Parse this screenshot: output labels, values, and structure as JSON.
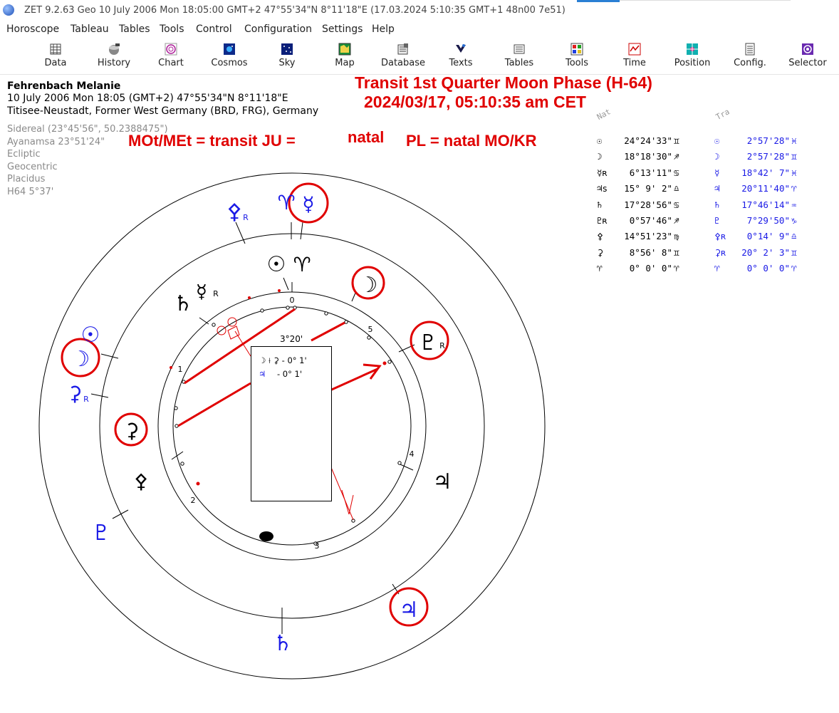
{
  "window": {
    "title": "ZET 9.2.63 Geo    10 July 2006  Mon  18:05:00 GMT+2 47°55'34\"N  8°11'18\"E  (17.03.2024   5:10:35 GMT+1 48n00 7e51)"
  },
  "menu": [
    "Horoscope",
    "Tableau",
    "Tables",
    "Tools",
    "Control",
    "Configuration",
    "Settings",
    "Help"
  ],
  "toolbar": [
    {
      "label": "Data",
      "icon": "data-grid-icon"
    },
    {
      "label": "History",
      "icon": "history-icon"
    },
    {
      "label": "Chart",
      "icon": "chart-wheel-icon"
    },
    {
      "label": "Cosmos",
      "icon": "cosmos-icon"
    },
    {
      "label": "Sky",
      "icon": "sky-icon"
    },
    {
      "label": "Map",
      "icon": "map-icon"
    },
    {
      "label": "Database",
      "icon": "database-icon"
    },
    {
      "label": "Texts",
      "icon": "texts-icon"
    },
    {
      "label": "Tables",
      "icon": "tables-icon"
    },
    {
      "label": "Tools",
      "icon": "tools-icon"
    },
    {
      "label": "Time",
      "icon": "time-icon"
    },
    {
      "label": "Position",
      "icon": "position-icon"
    },
    {
      "label": "Config.",
      "icon": "config-icon"
    },
    {
      "label": "Selector",
      "icon": "selector-icon"
    }
  ],
  "person": {
    "name": "Fehrenbach Melanie",
    "datetime": "10 July 2006  Mon  18:05 (GMT+2) 47°55'34\"N  8°11'18\"E",
    "place": "Titisee-Neustadt, Former West Germany (BRD, FRG), Germany"
  },
  "settings": [
    "Sidereal (23°45'56\", 50.2388475\")",
    "Ayanamsa 23°51'24\"",
    "Ecliptic",
    "Geocentric",
    "Placidus",
    "H64   5°37'"
  ],
  "annotations": {
    "title1": "Transit 1st Quarter Moon Phase (H-64)",
    "title2": "2024/03/17, 05:10:35 am CET",
    "formula_a": "MOt/MEt = transit JU =",
    "formula_b": "natal",
    "formula_c": "PL = natal MO/KR"
  },
  "table": {
    "nat_header": "Nat",
    "tra_header": "Tra",
    "natal": [
      {
        "glyph": "☉",
        "value": "24°24'33\"",
        "sign": "♊"
      },
      {
        "glyph": "☽",
        "value": "18°18'30\"",
        "sign": "♐"
      },
      {
        "glyph": "☿ʀ",
        "value": "6°13'11\"",
        "sign": "♋"
      },
      {
        "glyph": "♃s",
        "value": "15° 9' 2\"",
        "sign": "♎"
      },
      {
        "glyph": "♄",
        "value": "17°28'56\"",
        "sign": "♋"
      },
      {
        "glyph": "♇ʀ",
        "value": "0°57'46\"",
        "sign": "♐"
      },
      {
        "glyph": "⚴",
        "value": "14°51'23\"",
        "sign": "♍"
      },
      {
        "glyph": "⚳",
        "value": "8°56' 8\"",
        "sign": "♊"
      },
      {
        "glyph": "♈",
        "value": "0° 0' 0\"",
        "sign": "♈"
      }
    ],
    "transit": [
      {
        "glyph": "☉",
        "value": "2°57'28\"",
        "sign": "♓"
      },
      {
        "glyph": "☽",
        "value": "2°57'28\"",
        "sign": "♊"
      },
      {
        "glyph": "☿",
        "value": "18°42' 7\"",
        "sign": "♓"
      },
      {
        "glyph": "♃",
        "value": "20°11'40\"",
        "sign": "♈"
      },
      {
        "glyph": "♄",
        "value": "17°46'14\"",
        "sign": "♒"
      },
      {
        "glyph": "♇",
        "value": "7°29'50\"",
        "sign": "♑"
      },
      {
        "glyph": "⚴ʀ",
        "value": "0°14' 9\"",
        "sign": "♎"
      },
      {
        "glyph": "⚳ʀ",
        "value": "20° 2' 3\"",
        "sign": "♊"
      },
      {
        "glyph": "♈",
        "value": "0° 0' 0\"",
        "sign": "♈"
      }
    ]
  },
  "popup": {
    "header": "3°20'",
    "row1": "☽ ⟊ ⚳ - 0° 1'",
    "row2_glyph": "♃",
    "row2_value": "- 0° 1'"
  },
  "wheel": {
    "house_numbers": [
      "1",
      "2",
      "3",
      "4",
      "5",
      "0"
    ],
    "outer_glyphs": [
      {
        "g": "⚴",
        "r": "R",
        "color": "#1a1ae6"
      },
      {
        "g": "♈",
        "color": "#1a1ae6"
      },
      {
        "g": "☿",
        "color": "#1a1ae6"
      },
      {
        "g": "☉",
        "color": "#1a1ae6"
      },
      {
        "g": "☽",
        "color": "#1a1ae6"
      },
      {
        "g": "⚳",
        "r": "R",
        "color": "#1a1ae6"
      },
      {
        "g": "♇",
        "color": "#1a1ae6"
      },
      {
        "g": "♃",
        "color": "#1a1ae6"
      },
      {
        "g": "♄",
        "color": "#1a1ae6"
      }
    ],
    "inner_glyphs": [
      {
        "g": "☉",
        "color": "#000"
      },
      {
        "g": "♈",
        "color": "#000"
      },
      {
        "g": "☽",
        "color": "#000"
      },
      {
        "g": "♇",
        "r": "R",
        "color": "#000"
      },
      {
        "g": "♄",
        "color": "#000"
      },
      {
        "g": "☿",
        "r": "R",
        "color": "#000"
      },
      {
        "g": "⚳",
        "color": "#000"
      },
      {
        "g": "⚴",
        "color": "#000"
      },
      {
        "g": "♃",
        "color": "#000"
      }
    ],
    "colors": {
      "transit": "#1a1ae6",
      "natal": "#000000",
      "highlight": "#e00000"
    }
  }
}
